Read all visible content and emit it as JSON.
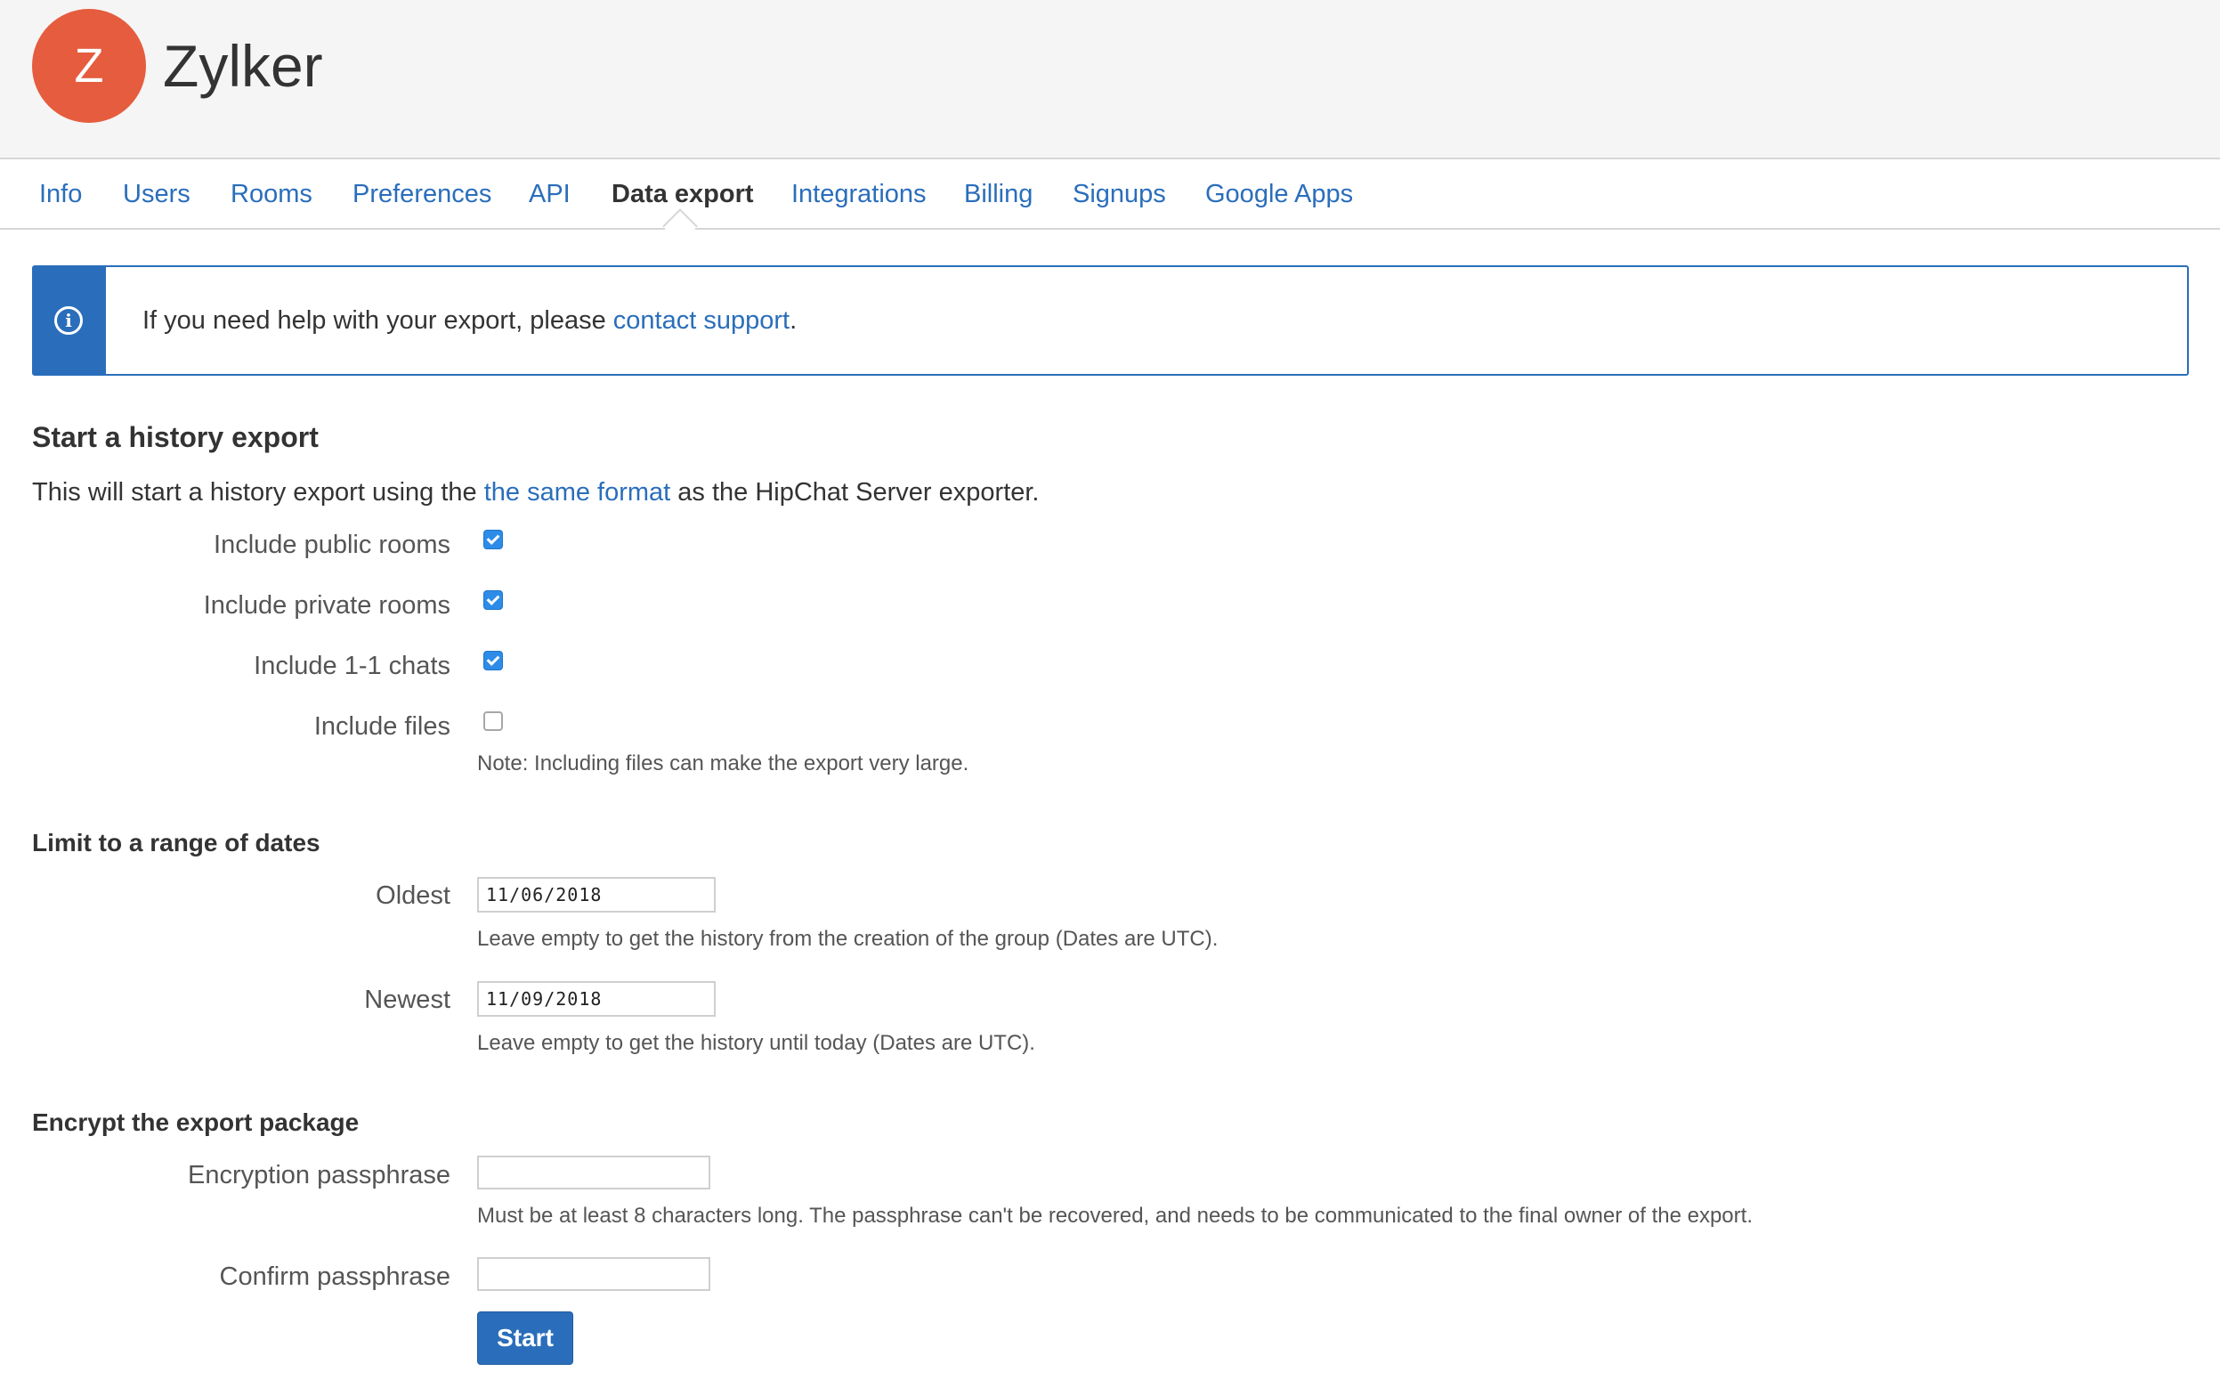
{
  "header": {
    "logo_letter": "Z",
    "org_name": "Zylker",
    "logo_color": "#e65c3e"
  },
  "tabs": [
    {
      "label": "Info",
      "active": false
    },
    {
      "label": "Users",
      "active": false
    },
    {
      "label": "Rooms",
      "active": false
    },
    {
      "label": "Preferences",
      "active": false
    },
    {
      "label": "API",
      "active": false
    },
    {
      "label": "Data export",
      "active": true
    },
    {
      "label": "Integrations",
      "active": false
    },
    {
      "label": "Billing",
      "active": false
    },
    {
      "label": "Signups",
      "active": false
    },
    {
      "label": "Google Apps",
      "active": false
    }
  ],
  "info_banner": {
    "icon": "info-icon",
    "text_before": "If you need help with your export, please ",
    "link_text": "contact support",
    "text_after": "."
  },
  "history_export": {
    "title": "Start a history export",
    "intro_before": "This will start a history export using the ",
    "intro_link": "the same format",
    "intro_after": " as the HipChat Server exporter.",
    "options": [
      {
        "label": "Include public rooms",
        "checked": true
      },
      {
        "label": "Include private rooms",
        "checked": true
      },
      {
        "label": "Include 1-1 chats",
        "checked": true
      },
      {
        "label": "Include files",
        "checked": false
      }
    ],
    "files_note": "Note: Including files can make the export very large."
  },
  "date_range": {
    "title": "Limit to a range of dates",
    "oldest_label": "Oldest",
    "oldest_value": "11/06/2018",
    "oldest_help": "Leave empty to get the history from the creation of the group (Dates are UTC).",
    "newest_label": "Newest",
    "newest_value": "11/09/2018",
    "newest_help": "Leave empty to get the history until today (Dates are UTC)."
  },
  "encryption": {
    "title": "Encrypt the export package",
    "passphrase_label": "Encryption passphrase",
    "passphrase_value": "",
    "passphrase_help": "Must be at least 8 characters long. The passphrase can't be recovered, and needs to be communicated to the final owner of the export.",
    "confirm_label": "Confirm passphrase",
    "confirm_value": ""
  },
  "actions": {
    "start_label": "Start"
  },
  "colors": {
    "accent": "#2a6ebb",
    "checkbox": "#2d8ce8"
  }
}
